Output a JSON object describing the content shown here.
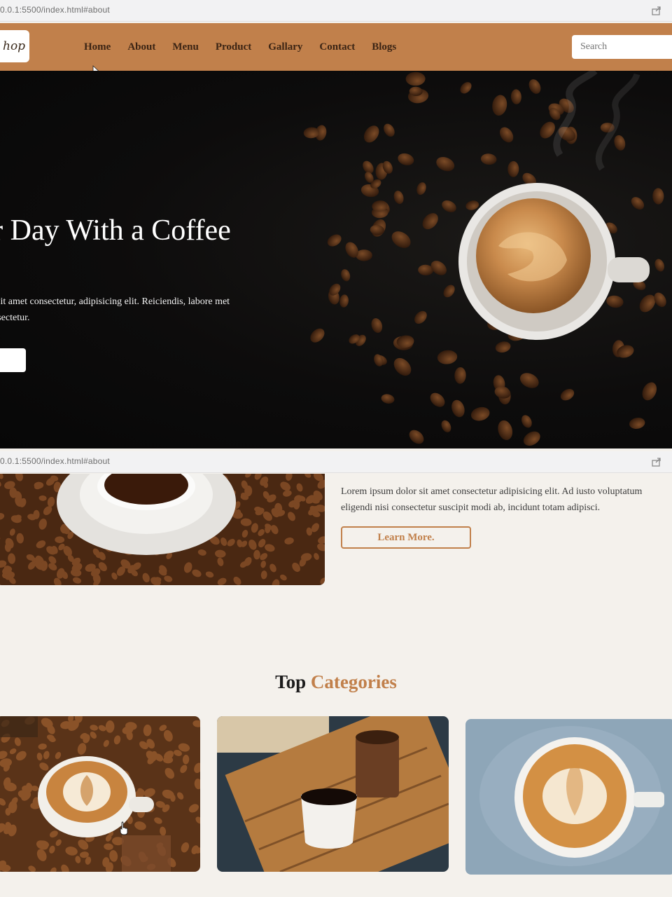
{
  "browser": {
    "url_top": "0.0.1:5500/index.html#about",
    "url_bottom": "0.0.1:5500/index.html#about"
  },
  "logo": {
    "text": "hop"
  },
  "nav": {
    "links": [
      "Home",
      "About",
      "Menu",
      "Product",
      "Gallary",
      "Contact",
      "Blogs"
    ]
  },
  "search": {
    "placeholder": "Search"
  },
  "hero": {
    "title": "Your Day With a Coffee",
    "text": "lor sit amet consectetur, adipisicing elit. Reiciendis, labore met consectetur."
  },
  "about": {
    "text": "Lorem ipsum dolor sit amet consectetur adipisicing elit. Ad iusto voluptatum eligendi nisi consectetur suscipit modi ab, incidunt totam adipisci.",
    "button_label": "Learn More."
  },
  "categories": {
    "title_part1": "Top",
    "title_part2": "Categories"
  },
  "colors": {
    "accent": "#c1804b",
    "hero_bg": "#0b0b0b",
    "page_bg": "#f4f1ec"
  },
  "icons": [
    "share-icon",
    "cursor-icon",
    "hand-cursor-icon"
  ]
}
